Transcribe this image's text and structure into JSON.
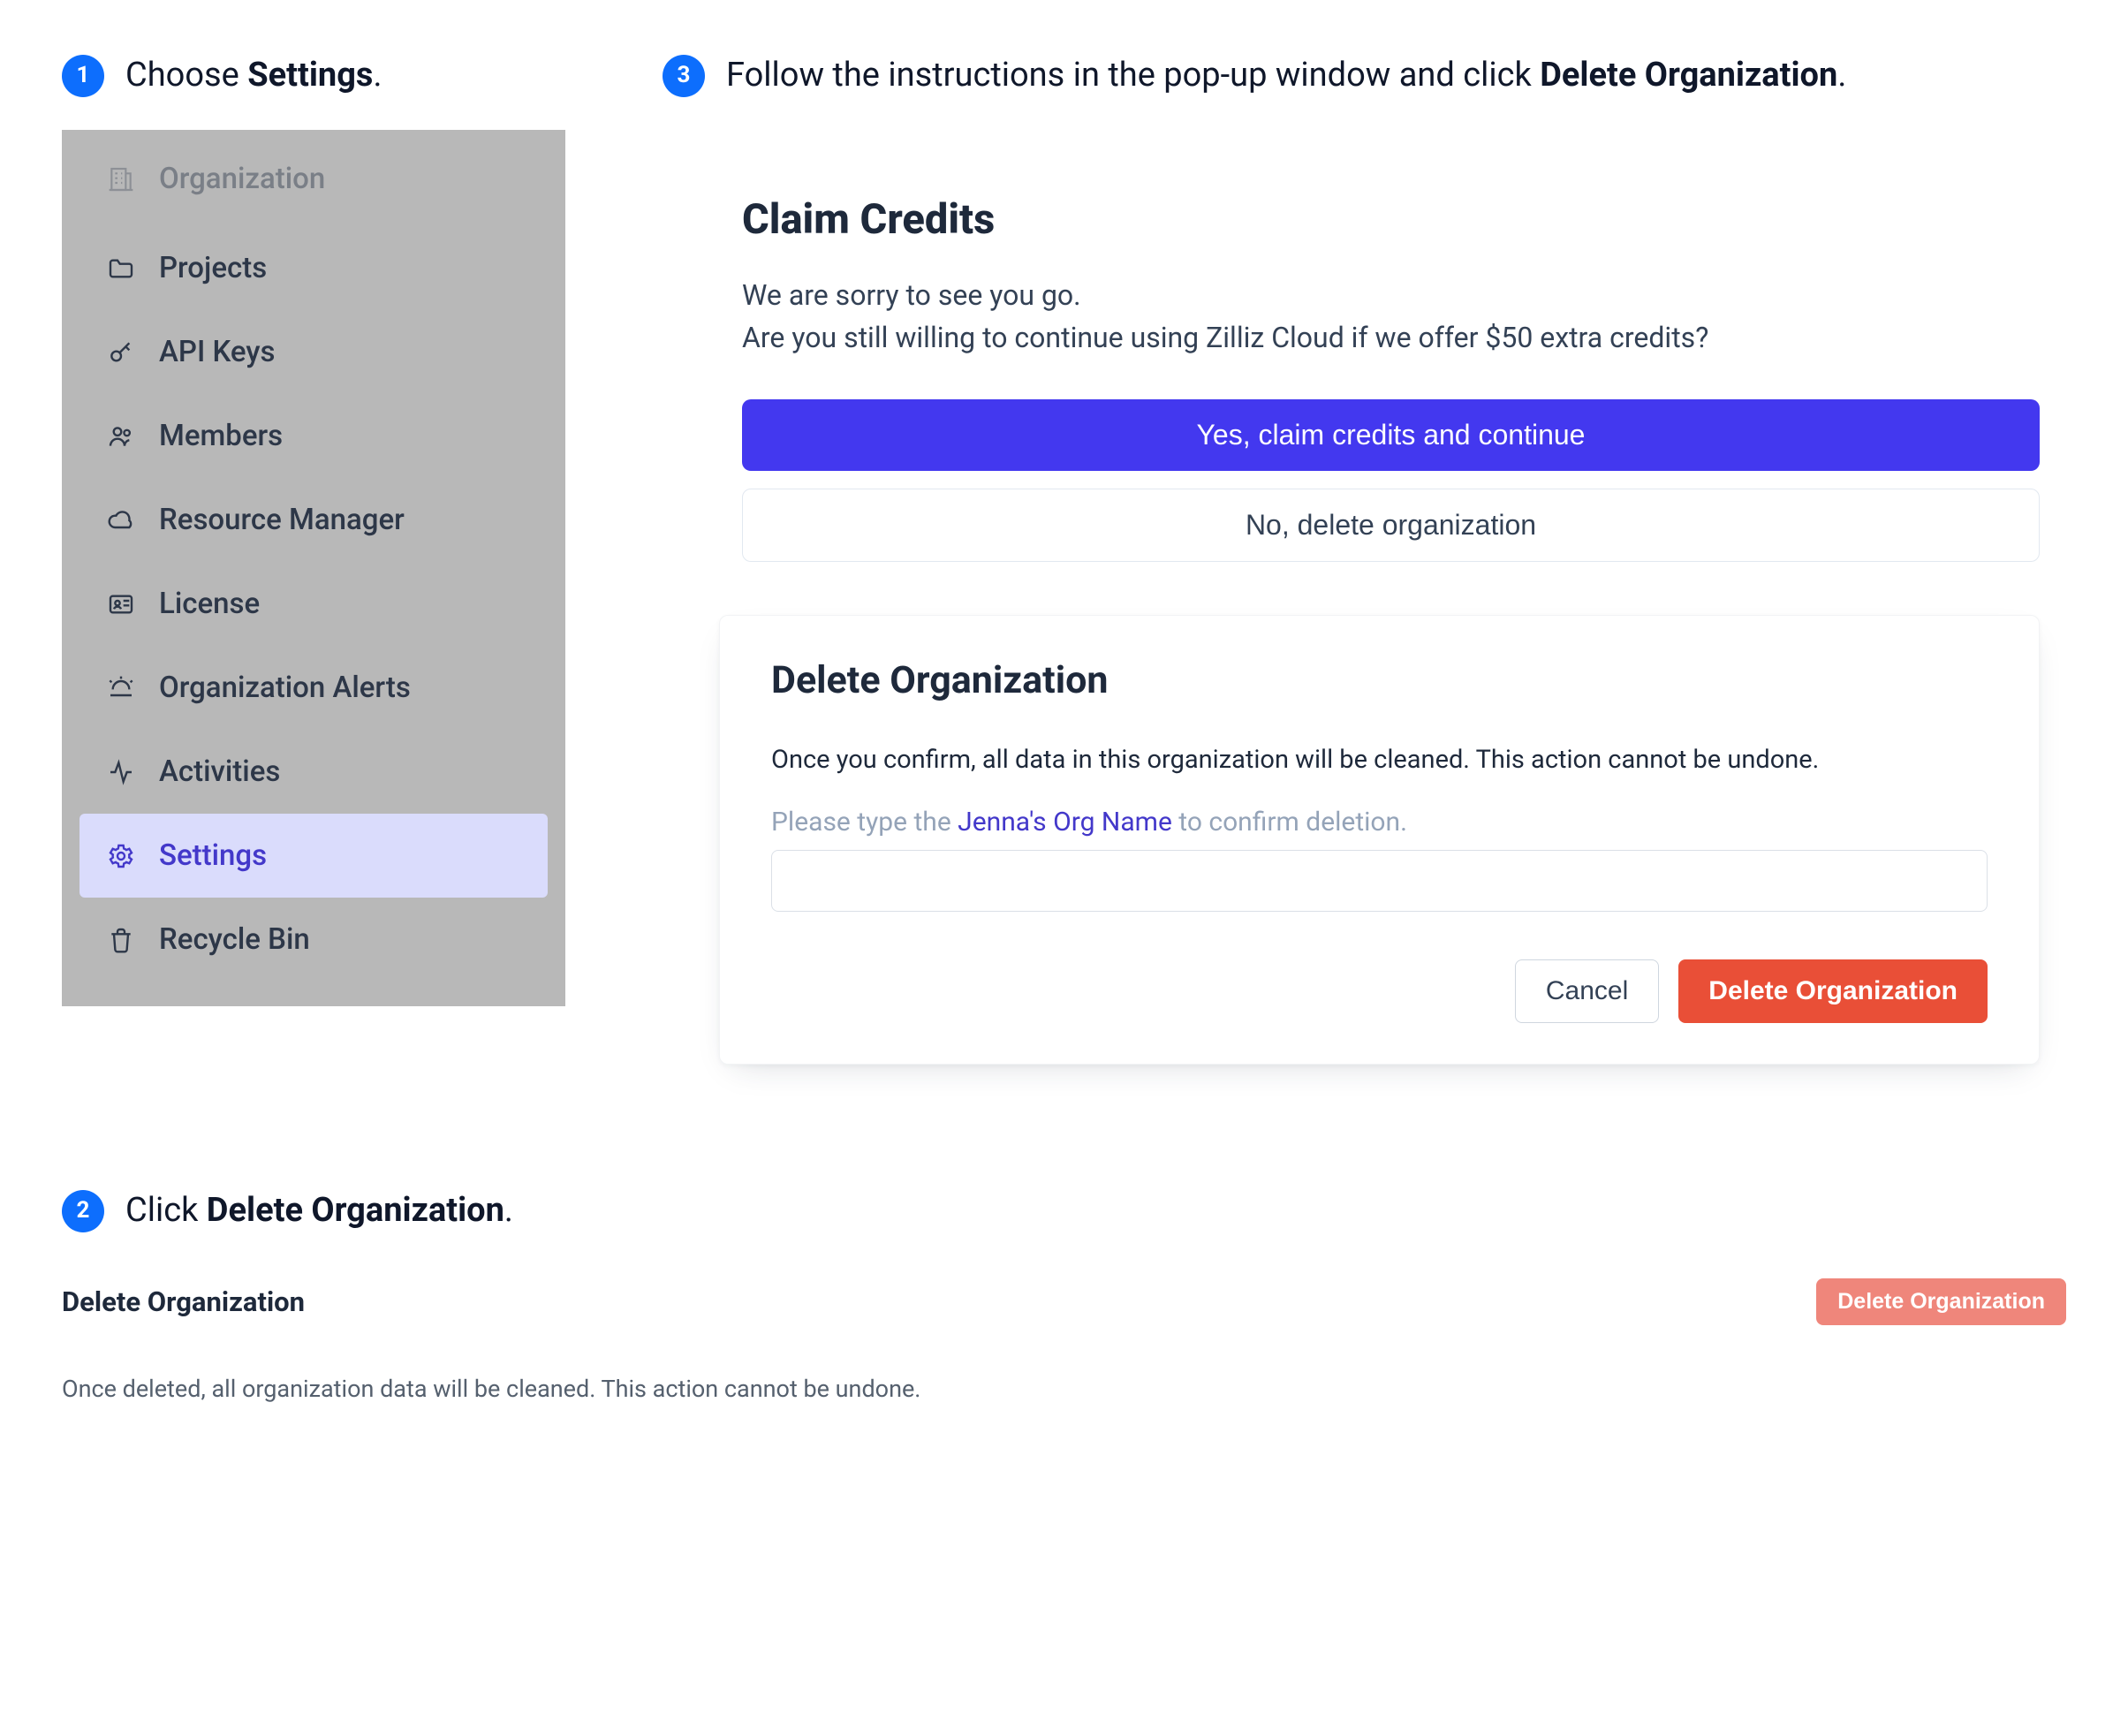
{
  "step1": {
    "pre": "Choose ",
    "bold": "Settings",
    "post": "."
  },
  "step2": {
    "pre": "Click ",
    "bold": "Delete Organization",
    "post": "."
  },
  "step3": {
    "pre": "Follow the instructions in the pop-up window and click ",
    "bold": "Delete Organization",
    "post": "."
  },
  "sidebar": {
    "heading": "Organization",
    "items": [
      {
        "id": "projects",
        "label": "Projects"
      },
      {
        "id": "api-keys",
        "label": "API Keys"
      },
      {
        "id": "members",
        "label": "Members"
      },
      {
        "id": "resource-manager",
        "label": "Resource Manager"
      },
      {
        "id": "license",
        "label": "License"
      },
      {
        "id": "org-alerts",
        "label": "Organization Alerts"
      },
      {
        "id": "activities",
        "label": "Activities"
      },
      {
        "id": "settings",
        "label": "Settings"
      },
      {
        "id": "recycle-bin",
        "label": "Recycle Bin"
      }
    ]
  },
  "claim": {
    "title": "Claim Credits",
    "line1": "We are sorry to see you go.",
    "line2": "Are you still willing to continue using Zilliz Cloud if we offer $50 extra credits?",
    "yes": "Yes, claim credits and continue",
    "no": "No, delete organization"
  },
  "dialog": {
    "title": "Delete Organization",
    "desc": "Once you confirm, all data in this organization will be cleaned. This action cannot be undone.",
    "hint_pre": "Please type the ",
    "hint_org": "Jenna's Org Name",
    "hint_post": " to confirm deletion.",
    "cancel": "Cancel",
    "delete": "Delete Organization"
  },
  "settings_row": {
    "title": "Delete Organization",
    "button": "Delete Organization",
    "desc": "Once deleted, all organization data will be cleaned. This action cannot be undone."
  }
}
